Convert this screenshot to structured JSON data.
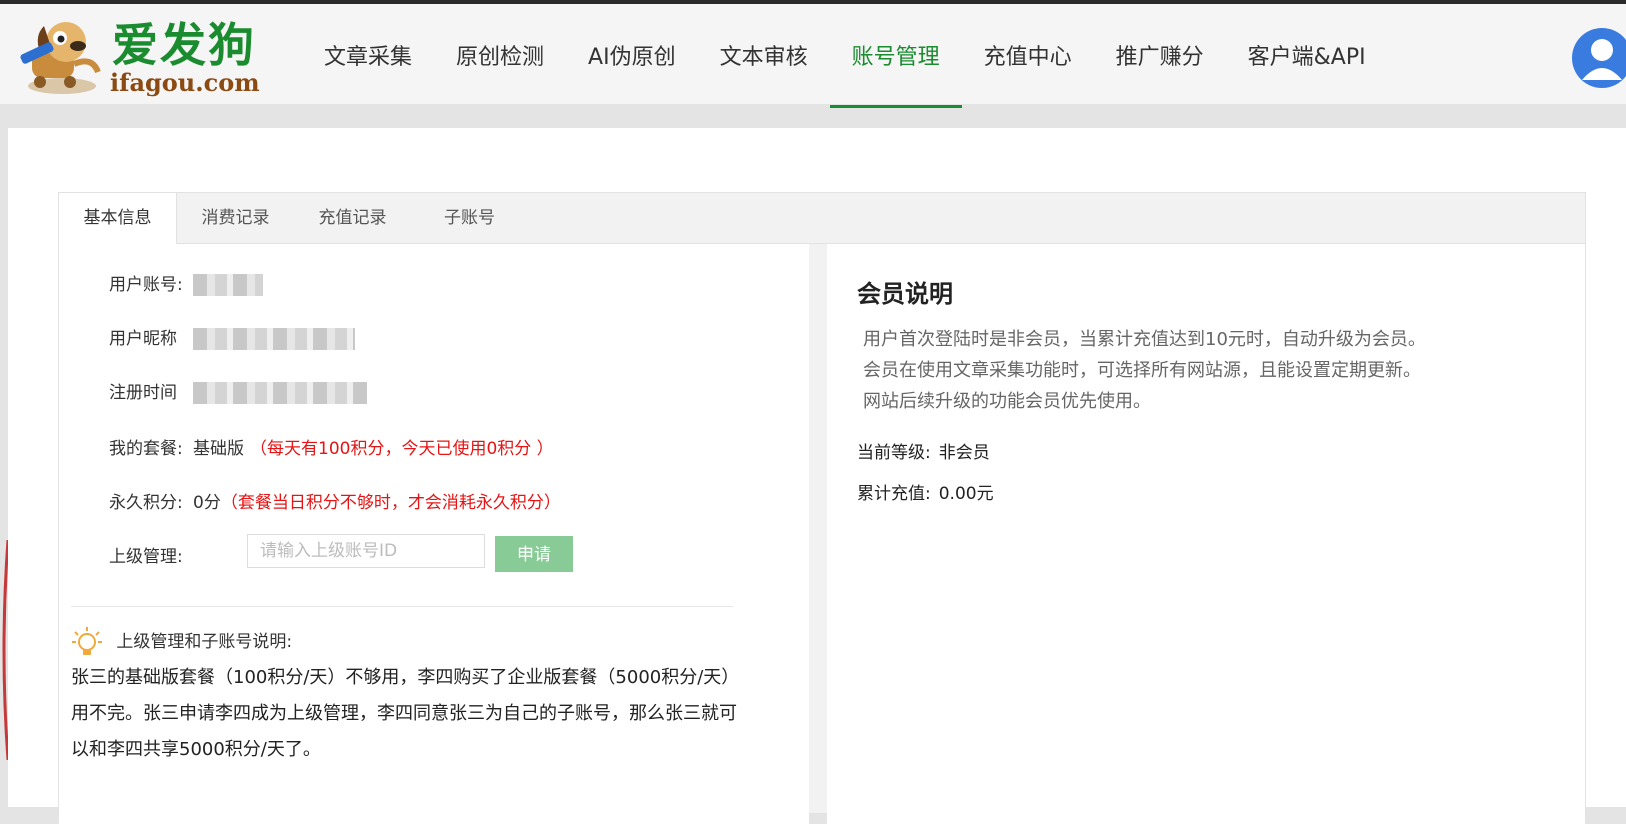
{
  "header": {
    "logo_cn": "爱发狗",
    "logo_url": "ifagou.com",
    "nav": [
      {
        "label": "文章采集"
      },
      {
        "label": "原创检测"
      },
      {
        "label": "AI伪原创"
      },
      {
        "label": "文本审核"
      },
      {
        "label": "账号管理",
        "active": true
      },
      {
        "label": "充值中心"
      },
      {
        "label": "推广赚分"
      },
      {
        "label": "客户端&API"
      }
    ]
  },
  "tabs": [
    "基本信息",
    "消费记录",
    "充值记录",
    "子账号"
  ],
  "info": {
    "account_label": "用户账号:",
    "nickname_label": "用户昵称",
    "reg_label": "注册时间",
    "plan_label": "我的套餐:",
    "plan_value": "基础版",
    "plan_note": "（每天有100积分，今天已使用0积分 ）",
    "perm_label": "永久积分:",
    "perm_value": "0分",
    "perm_note": "（套餐当日积分不够时，才会消耗永久积分）",
    "super_label": "上级管理:",
    "super_placeholder": "请输入上级账号ID",
    "apply_button": "申请"
  },
  "tip": {
    "title": "上级管理和子账号说明:",
    "text": "张三的基础版套餐（100积分/天）不够用，李四购买了企业版套餐（5000积分/天）用不完。张三申请李四成为上级管理，李四同意张三为自己的子账号，那么张三就可以和李四共享5000积分/天了。"
  },
  "member": {
    "title": "会员说明",
    "desc": [
      "用户首次登陆时是非会员，当累计充值达到10元时，自动升级为会员。",
      "会员在使用文章采集功能时，可选择所有网站源，且能设置定期更新。",
      "网站后续升级的功能会员优先使用。"
    ],
    "level_label": "当前等级:",
    "level_value": "非会员",
    "total_label": "累计充值:",
    "total_value": "0.00元"
  },
  "colors": {
    "brand_green": "#1a8c2f",
    "button_green": "#88cb96",
    "note_red": "#e61414",
    "avatar_blue": "#3a7be0"
  }
}
